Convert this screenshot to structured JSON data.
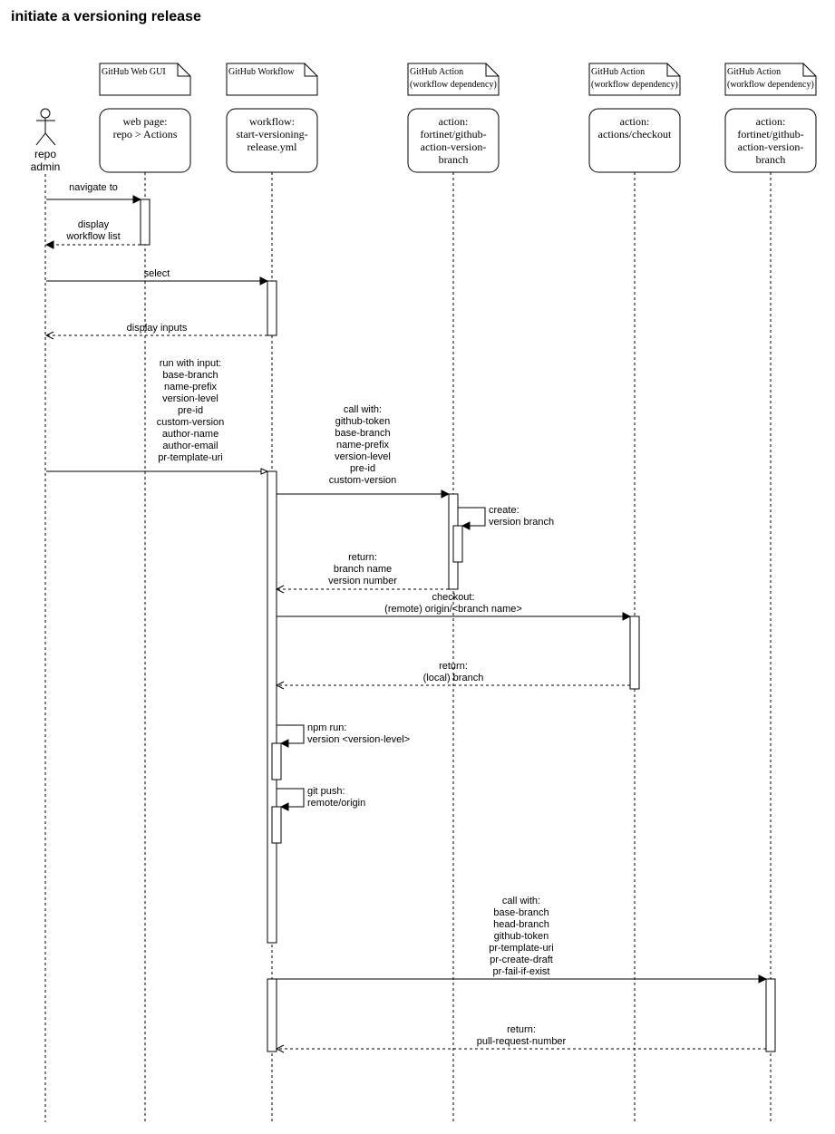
{
  "title": "initiate a versioning release",
  "actor": {
    "label_lines": [
      "repo",
      "admin"
    ]
  },
  "participants": [
    {
      "id": "gui",
      "note_lines": [
        "GitHub Web GUI"
      ],
      "box_lines": [
        "web page:",
        "repo > Actions"
      ]
    },
    {
      "id": "wf",
      "note_lines": [
        "GitHub Workflow"
      ],
      "box_lines": [
        "workflow:",
        "start-versioning-",
        "release.yml"
      ]
    },
    {
      "id": "vb",
      "note_lines": [
        "GitHub Action",
        "(workflow dependency)"
      ],
      "box_lines": [
        "action:",
        "fortinet/github-",
        "action-version-",
        "branch"
      ]
    },
    {
      "id": "co",
      "note_lines": [
        "GitHub Action",
        "(workflow dependency)"
      ],
      "box_lines": [
        "action:",
        "actions/checkout"
      ]
    },
    {
      "id": "pr",
      "note_lines": [
        "GitHub Action",
        "(workflow dependency)"
      ],
      "box_lines": [
        "action:",
        "fortinet/github-",
        "action-version-",
        "branch"
      ]
    }
  ],
  "messages": [
    {
      "from": "actor",
      "to": "gui",
      "type": "sync",
      "label_lines": [
        "navigate to"
      ]
    },
    {
      "from": "gui",
      "to": "actor",
      "type": "return-filled",
      "label_lines": [
        "display",
        "workflow list"
      ]
    },
    {
      "from": "actor",
      "to": "wf",
      "type": "sync",
      "label_lines": [
        "select"
      ]
    },
    {
      "from": "wf",
      "to": "actor",
      "type": "return",
      "label_lines": [
        "display inputs"
      ]
    },
    {
      "from": "actor",
      "to": "wf",
      "type": "async",
      "label_lines": [
        "run with input:",
        "base-branch",
        "name-prefix",
        "version-level",
        "pre-id",
        "custom-version",
        "author-name",
        "author-email",
        "pr-template-uri"
      ]
    },
    {
      "from": "wf",
      "to": "vb",
      "type": "sync",
      "label_lines": [
        "call with:",
        "github-token",
        "base-branch",
        "name-prefix",
        "version-level",
        "pre-id",
        "custom-version"
      ]
    },
    {
      "from": "vb",
      "to": "vb",
      "type": "self",
      "label_lines": [
        "create:",
        "version branch"
      ]
    },
    {
      "from": "vb",
      "to": "wf",
      "type": "return",
      "label_lines": [
        "return:",
        "branch name",
        "version number"
      ]
    },
    {
      "from": "wf",
      "to": "co",
      "type": "sync",
      "label_lines": [
        "checkout:",
        "(remote) origin/<branch name>"
      ]
    },
    {
      "from": "co",
      "to": "wf",
      "type": "return",
      "label_lines": [
        "return:",
        "(local) branch"
      ]
    },
    {
      "from": "wf",
      "to": "wf",
      "type": "self",
      "label_lines": [
        "npm run:",
        "version <version-level>"
      ]
    },
    {
      "from": "wf",
      "to": "wf",
      "type": "self",
      "label_lines": [
        "git push:",
        "remote/origin"
      ]
    },
    {
      "from": "wf",
      "to": "pr",
      "type": "sync",
      "label_lines": [
        "call with:",
        "base-branch",
        "head-branch",
        "github-token",
        "pr-template-uri",
        "pr-create-draft",
        "pr-fail-if-exist"
      ]
    },
    {
      "from": "pr",
      "to": "wf",
      "type": "return",
      "label_lines": [
        "return:",
        "pull-request-number"
      ]
    }
  ]
}
